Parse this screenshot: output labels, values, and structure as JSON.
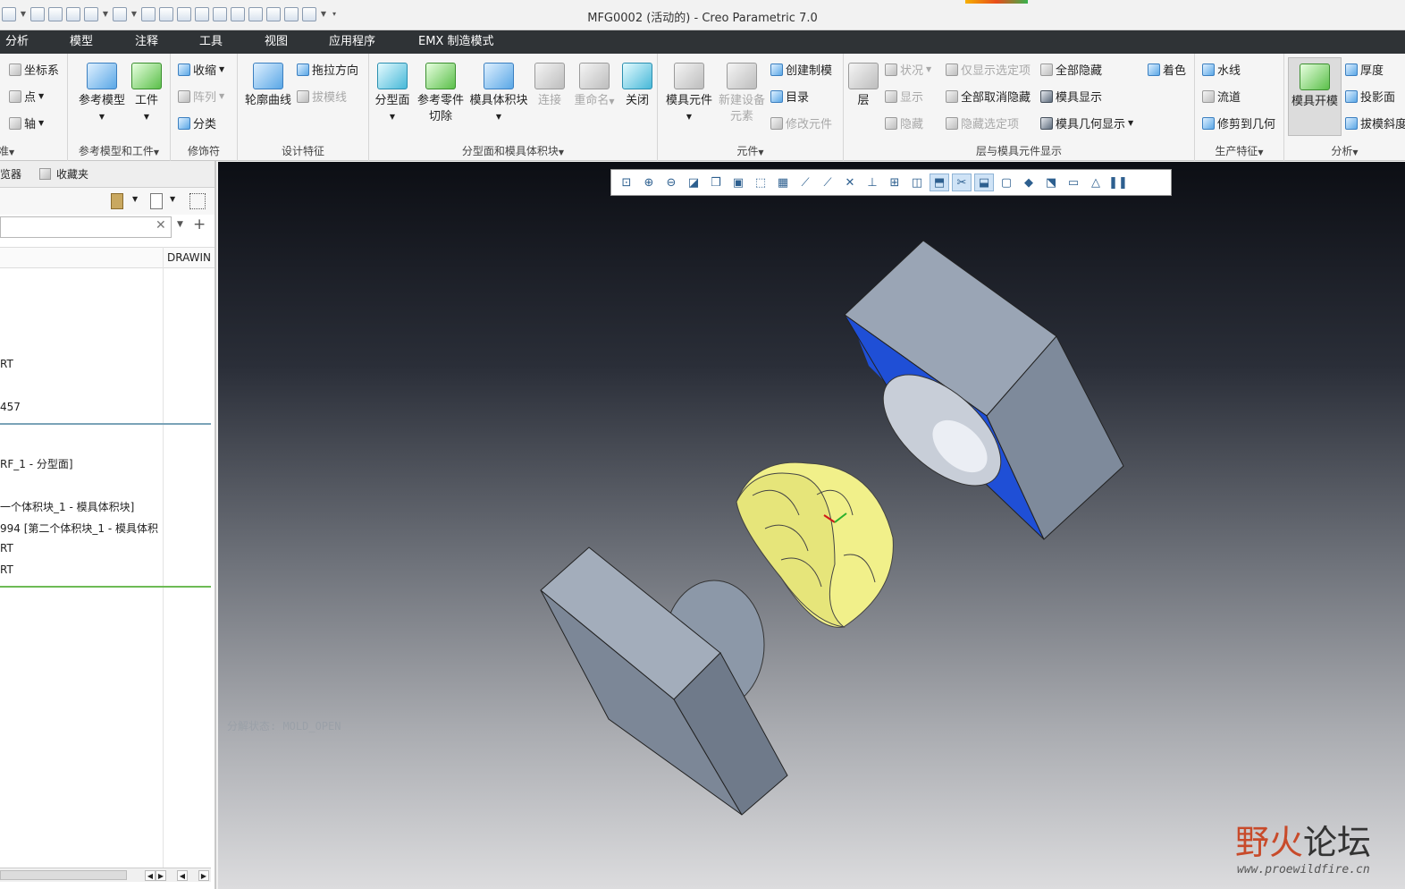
{
  "window": {
    "title": "MFG0002 (活动的) - Creo Parametric 7.0"
  },
  "tabs": [
    "分析",
    "模型",
    "注释",
    "工具",
    "视图",
    "应用程序",
    "EMX 制造模式"
  ],
  "ribbon": {
    "datum": {
      "label": "准",
      "coord_sys": "坐标系",
      "point": "点",
      "axis": "轴"
    },
    "ref_model": {
      "label": "参考模型和工件",
      "ref_model_btn": "参考模型",
      "workpiece_btn": "工件"
    },
    "modifier": {
      "label": "修饰符",
      "shrink": "收缩",
      "pattern": "阵列",
      "classify": "分类"
    },
    "design_feat": {
      "label": "设计特征",
      "profile_curve": "轮廓曲线",
      "pull_dir": "拖拉方向",
      "draft_line": "拔模线"
    },
    "parting": {
      "label": "分型面和模具体积块",
      "parting_surface": "分型面",
      "ref_cut": "参考零件切除",
      "mold_volume": "模具体积块",
      "connect": "连接",
      "rename": "重命名",
      "close": "关闭"
    },
    "component": {
      "label": "元件",
      "mold_comp": "模具元件",
      "new_elem": "新建设备元素",
      "create_mold": "创建制模",
      "catalog": "目录",
      "modify_comp": "修改元件"
    },
    "layers": {
      "label": "层与模具元件显示",
      "layer": "层",
      "status": "状况",
      "show": "显示",
      "hide": "隐藏",
      "show_only": "仅显示选定项",
      "unhide_all": "全部取消隐藏",
      "hide_selected": "隐藏选定项",
      "hide_all": "全部隐藏",
      "mold_display": "模具显示",
      "mold_geom_display": "模具几何显示",
      "shade": "着色"
    },
    "production": {
      "label": "生产特征",
      "waterline": "水线",
      "runner": "流道",
      "trim_geom": "修剪到几何"
    },
    "analysis": {
      "label": "分析",
      "mold_open": "模具开模",
      "thickness": "厚度",
      "proj_area": "投影面",
      "draft_check": "拔模斜度"
    }
  },
  "nav": {
    "browser_tab": "浏览器",
    "favorites_tab": "收藏夹",
    "column_drawing": "DRAWIN"
  },
  "tree": [
    {
      "text": "RT"
    },
    {
      "text": "457"
    },
    {
      "text": "RF_1 - 分型面]"
    },
    {
      "text": "一个体积块_1 - 模具体积块]"
    },
    {
      "text": "994 [第二个体积块_1 - 模具体积"
    },
    {
      "text": "RT"
    },
    {
      "text": "RT"
    }
  ],
  "viewport": {
    "explode_state": "分解状态: MOLD_OPEN"
  },
  "watermark": {
    "brand_a": "野",
    "brand_b": "火",
    "brand_c": "论坛",
    "url": "www.proewildfire.cn"
  },
  "colors": {
    "tabbar": "#2f3336",
    "mold_blue": "#1f4fd6",
    "part_yellow": "#f1f08a",
    "plate_gray": "#8c98a8"
  }
}
